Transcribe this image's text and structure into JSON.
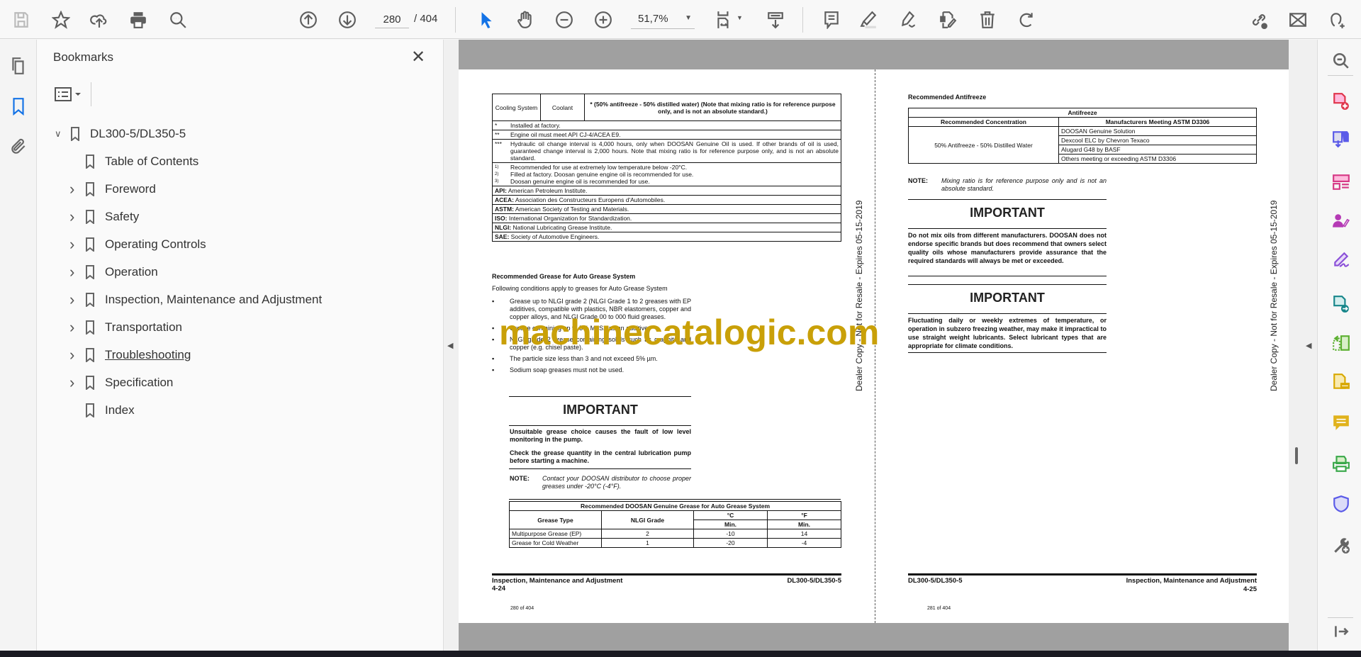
{
  "toolbar": {
    "page_current": "280",
    "page_total": "/ 404",
    "zoom": "51,7%"
  },
  "bookmarks": {
    "title": "Bookmarks",
    "root": "DL300-5/DL350-5",
    "items": [
      {
        "label": "Table of Contents",
        "expandable": false
      },
      {
        "label": "Foreword",
        "expandable": true
      },
      {
        "label": "Safety",
        "expandable": true
      },
      {
        "label": "Operating Controls",
        "expandable": true
      },
      {
        "label": "Operation",
        "expandable": true
      },
      {
        "label": "Inspection, Maintenance and Adjustment",
        "expandable": true
      },
      {
        "label": "Transportation",
        "expandable": true
      },
      {
        "label": "Troubleshooting",
        "expandable": true
      },
      {
        "label": "Specification",
        "expandable": true
      },
      {
        "label": "Index",
        "expandable": false
      }
    ]
  },
  "watermark": "machinecatalogic.com",
  "left_page": {
    "cooling": {
      "system": "Cooling System",
      "coolant": "Coolant",
      "spec": "* (50% antifreeze - 50% distilled water) (Note that mixing ratio is for reference purpose only, and is not an absolute standard.)"
    },
    "notes": [
      {
        "mark": "*",
        "text": "Installed at factory."
      },
      {
        "mark": "**",
        "text": "Engine oil must meet API CJ-4/ACEA E9."
      },
      {
        "mark": "***",
        "text": "Hydraulic oil change interval is 4,000 hours, only when DOOSAN Genuine Oil is used. If other brands of oil is used, guaranteed change interval is 2,000 hours. Note that mixing ratio is for reference purpose only, and is not an absolute standard."
      }
    ],
    "footnotes": [
      {
        "mark": "1)",
        "text": "Recommended for use at extremely low temperature below -20°C."
      },
      {
        "mark": "2)",
        "text": "Filled at factory. Doosan genuine engine oil is recommended for use."
      },
      {
        "mark": "3)",
        "text": "Doosan genuine engine oil is recommended for use."
      }
    ],
    "abbreviations": [
      {
        "abbr": "API:",
        "text": " American Petroleum Institute."
      },
      {
        "abbr": "ACEA:",
        "text": " Association des Constructeurs Europens d'Automobiles."
      },
      {
        "abbr": "ASTM:",
        "text": " American Society of Testing and Materials."
      },
      {
        "abbr": "ISO:",
        "text": " International Organization for Standardization."
      },
      {
        "abbr": "NLGI:",
        "text": " National Lubricating Grease Institute."
      },
      {
        "abbr": "SAE:",
        "text": " Society of Automotive Engineers."
      }
    ],
    "grease_heading": "Recommended Grease for Auto Grease System",
    "grease_intro": "Following conditions apply to greases for Auto Grease System",
    "grease_bullets": [
      "Grease up to NLGI grade 2 (NLGI Grade 1 to 2 greases with EP additives, compatible with plastics, NBR elastomers, copper and copper alloys, and NLGI Grade 00 to 000 fluid greases.",
      "Grease containing up to 5% MoS2 as an additive.",
      "NLGI grade 2 grease containing solids such as graphite and copper (e.g. chisel paste).",
      "The particle size less than 3 and not exceed 5% µm.",
      "Sodium soap greases must not be used."
    ],
    "important_title": "IMPORTANT",
    "important_1": "Unsuitable grease choice causes the fault of low level monitoring in the pump.",
    "important_2": "Check the grease quantity in the central lubrication pump before starting a machine.",
    "note_label": "NOTE:",
    "note_text": "Contact your DOOSAN distributor to choose proper greases under -20°C (-4°F).",
    "grease_table": {
      "title": "Recommended DOOSAN Genuine Grease for Auto Grease System",
      "headers": [
        "Grease Type",
        "NLGI Grade",
        "°C",
        "°F"
      ],
      "subheaders": [
        "Min.",
        "Min."
      ],
      "rows": [
        [
          "Multipurpose Grease (EP)",
          "2",
          "-10",
          "14"
        ],
        [
          "Grease for Cold Weather",
          "1",
          "-20",
          "-4"
        ]
      ]
    },
    "footer_section": "Inspection, Maintenance and Adjustment",
    "footer_page": "4-24",
    "footer_model": "DL300-5/DL350-5",
    "page_of": "280 of 404",
    "side_stamp": "Dealer Copy - Not for Resale - Expires 05-15-2019"
  },
  "right_page": {
    "heading": "Recommended Antifreeze",
    "table": {
      "title": "Antifreeze",
      "headers": [
        "Recommended Concentration",
        "Manufacturers Meeting ASTM D3306"
      ],
      "concentration": "50% Antifreeze - 50% Distilled Water",
      "manufacturers": [
        "DOOSAN Genuine Solution",
        "Dexcool ELC by Chevron Texaco",
        "Alugard G48 by BASF",
        "Others meeting or exceeding ASTM D3306"
      ]
    },
    "note_label": "NOTE:",
    "note_text": "Mixing ratio is for reference purpose only and is not an absolute standard.",
    "important_title": "IMPORTANT",
    "important_1": "Do not mix oils from different manufacturers. DOOSAN does not endorse specific brands but does recommend that owners select quality oils whose manufacturers provide assurance that the required standards will always be met or exceeded.",
    "important_2": "Fluctuating daily or weekly extremes of temperature, or operation in subzero freezing weather, may make it impractical to use straight weight lubricants. Select lubricant types that are appropriate for climate conditions.",
    "footer_model": "DL300-5/DL350-5",
    "footer_section": "Inspection, Maintenance and Adjustment",
    "footer_page": "4-25",
    "page_of": "281 of 404",
    "side_stamp": "Dealer Copy - Not for Resale - Expires 05-15-2019"
  },
  "colors": {
    "accent": "#1473e6",
    "watermark": "#c9a008",
    "doc_bg": "#a0a0a0"
  }
}
